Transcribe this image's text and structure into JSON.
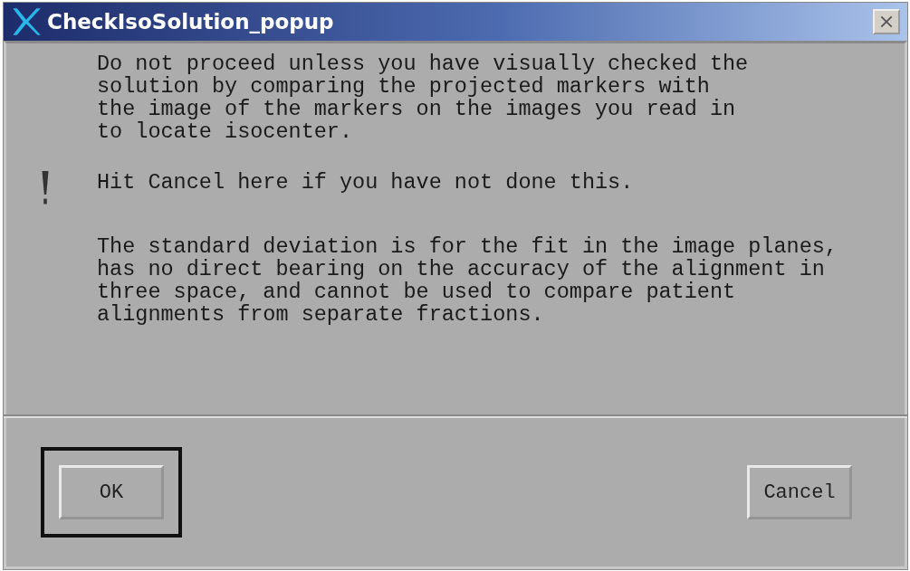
{
  "window": {
    "title": "CheckIsoSolution_popup"
  },
  "message": {
    "paragraphs": [
      {
        "lines": [
          "Do not proceed unless you have visually checked the",
          "solution by comparing the projected markers with",
          "the image of the markers on the images you read in",
          "to locate isocenter."
        ],
        "icon": false
      },
      {
        "lines": [
          "Hit Cancel here if you have not done this."
        ],
        "icon": true
      },
      {
        "lines": [
          "The standard deviation is for the fit in the image planes,",
          "has no direct bearing on the accuracy of the alignment in",
          "three space, and cannot be used to compare patient",
          "alignments from separate fractions."
        ],
        "icon": false
      }
    ]
  },
  "buttons": [
    {
      "label": "OK",
      "default": true
    },
    {
      "label": "Cancel",
      "default": false
    }
  ]
}
